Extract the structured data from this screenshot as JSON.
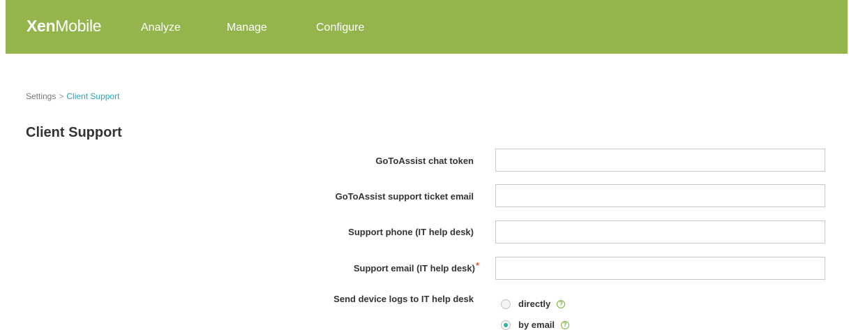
{
  "app": {
    "logo_bold": "Xen",
    "logo_light": "Mobile",
    "nav": [
      "Analyze",
      "Manage",
      "Configure"
    ]
  },
  "breadcrumb": {
    "parent": "Settings",
    "separator": ">",
    "current": "Client Support"
  },
  "page": {
    "title": "Client Support"
  },
  "form": {
    "fields": [
      {
        "label": "GoToAssist chat token",
        "value": "",
        "required": false
      },
      {
        "label": "GoToAssist support ticket email",
        "value": "",
        "required": false
      },
      {
        "label": "Support phone (IT help desk)",
        "value": "",
        "required": false
      },
      {
        "label": "Support email (IT help desk)",
        "value": "",
        "required": true,
        "required_marker": "*"
      }
    ],
    "send_logs": {
      "label": "Send device logs to IT help desk",
      "options": [
        {
          "label": "directly",
          "selected": false
        },
        {
          "label": "by email",
          "selected": true
        }
      ],
      "help_glyph": "?"
    }
  },
  "colors": {
    "topbar": "#93b54c",
    "accent": "#2aa3b8",
    "required": "#e05b38",
    "radio_selected": "#2bb5a6",
    "help": "#7ab33a"
  },
  "icons": [
    "help-circle-icon",
    "radio-unselected-icon",
    "radio-selected-icon"
  ]
}
